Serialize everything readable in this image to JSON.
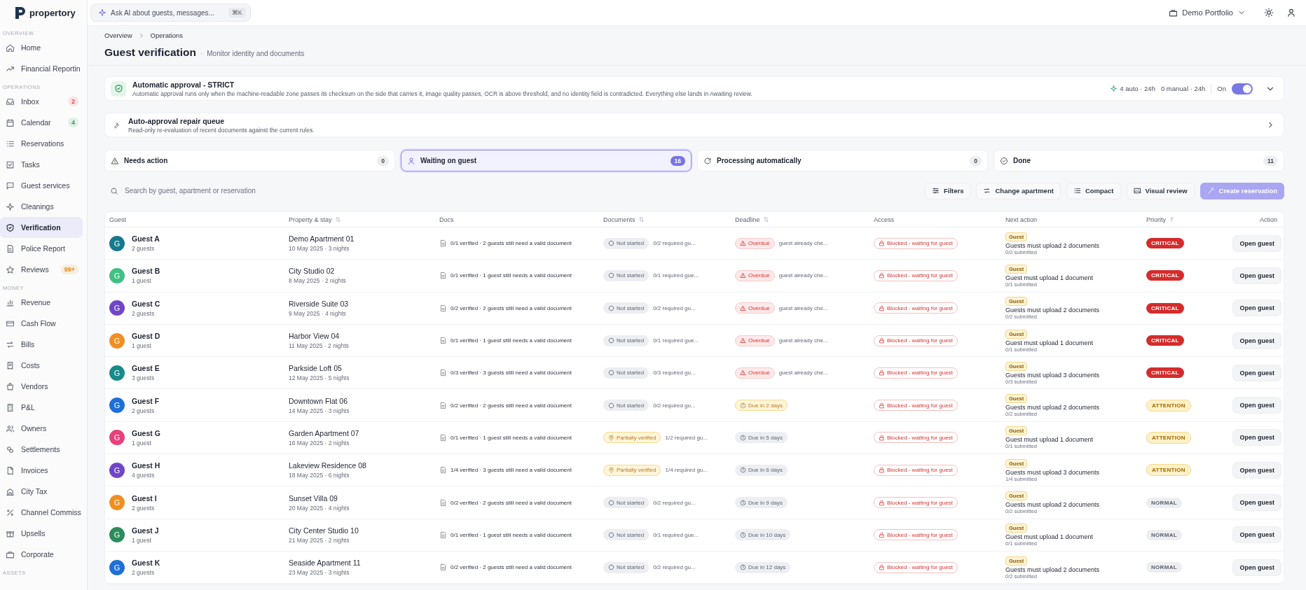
{
  "brand": {
    "name": "propertory"
  },
  "ai_search": {
    "placeholder": "Ask AI about guests, messages...",
    "shortcut": "⌘K"
  },
  "topbar": {
    "portfolio": "Demo Portfolio"
  },
  "sidebar": {
    "sections": [
      {
        "label": "OVERVIEW",
        "items": [
          {
            "label": "Home",
            "selected": false
          },
          {
            "label": "Financial Reportin",
            "selected": false
          }
        ]
      },
      {
        "label": "OPERATIONS",
        "items": [
          {
            "label": "Inbox",
            "selected": false,
            "badge": "2",
            "color": "#e5484d"
          },
          {
            "label": "Calendar",
            "selected": false,
            "badge": "4",
            "color": "#2f9e5b"
          },
          {
            "label": "Reservations",
            "selected": false
          },
          {
            "label": "Tasks",
            "selected": false
          },
          {
            "label": "Guest services",
            "selected": false
          },
          {
            "label": "Cleanings",
            "selected": false
          },
          {
            "label": "Verification",
            "selected": true
          },
          {
            "label": "Police Report",
            "selected": false
          },
          {
            "label": "Reviews",
            "selected": false,
            "badge": "99+",
            "color": "#e8891c"
          }
        ]
      },
      {
        "label": "MONEY",
        "items": [
          {
            "label": "Revenue",
            "selected": false
          },
          {
            "label": "Cash Flow",
            "selected": false
          },
          {
            "label": "Bills",
            "selected": false
          },
          {
            "label": "Costs",
            "selected": false
          },
          {
            "label": "Vendors",
            "selected": false
          },
          {
            "label": "P&L",
            "selected": false
          },
          {
            "label": "Owners",
            "selected": false
          },
          {
            "label": "Settlements",
            "selected": false
          },
          {
            "label": "Invoices",
            "selected": false
          },
          {
            "label": "City Tax",
            "selected": false
          },
          {
            "label": "Channel Commiss",
            "selected": false
          },
          {
            "label": "Upsells",
            "selected": false
          },
          {
            "label": "Corporate",
            "selected": false
          }
        ]
      },
      {
        "label": "ASSETS"
      }
    ]
  },
  "breadcrumb": [
    "Overview",
    "Operations"
  ],
  "page": {
    "title": "Guest verification",
    "separator": "·",
    "subtitle": "Monitor identity and documents"
  },
  "approval": {
    "title": "Automatic approval - STRICT",
    "description": "Automatic approval runs only when the machine-readable zone passes its checksum on the side that carries it, image quality passes, OCR is above threshold, and no identity field is contradicted. Everything else lands in Awaiting review.",
    "auto_stat": "4 auto · 24h",
    "manual_stat": "0 manual · 24h",
    "toggle_label": "On",
    "toggle_on": true
  },
  "repair": {
    "title": "Auto-approval repair queue",
    "description": "Read-only re-evaluation of recent documents against the current rules."
  },
  "tabs": [
    {
      "kind": "attention",
      "label": "Needs action",
      "count": "0",
      "selected": false
    },
    {
      "kind": "waiting",
      "label": "Waiting on guest",
      "count": "16",
      "selected": true
    },
    {
      "kind": "processing",
      "label": "Processing automatically",
      "count": "0",
      "selected": false
    },
    {
      "kind": "done",
      "label": "Done",
      "count": "11",
      "selected": false
    }
  ],
  "search": {
    "placeholder": "Search by guest, apartment or reservation"
  },
  "toolbar": [
    {
      "label": "Filters",
      "kind": "normal"
    },
    {
      "label": "Change apartment",
      "kind": "normal"
    },
    {
      "label": "Compact",
      "kind": "normal"
    },
    {
      "label": "Visual review",
      "kind": "normal"
    },
    {
      "label": "Create reservation",
      "kind": "primary"
    }
  ],
  "table": {
    "columns": [
      {
        "label": "Guest",
        "sortable": false,
        "sorted": false
      },
      {
        "label": "Property & stay",
        "sortable": true,
        "sorted": false
      },
      {
        "label": "Docs",
        "sortable": false,
        "sorted": false
      },
      {
        "label": "Documents",
        "sortable": true,
        "sorted": false
      },
      {
        "label": "Deadline",
        "sortable": true,
        "sorted": false
      },
      {
        "label": "Access",
        "sortable": false,
        "sorted": false
      },
      {
        "label": "Next action",
        "sortable": false,
        "sorted": false
      },
      {
        "label": "Priority",
        "sortable": false,
        "sorted": true
      },
      {
        "label": "Action",
        "sortable": false,
        "sorted": false
      }
    ],
    "rows": [
      {
        "avatar": "G",
        "color": "#17798c",
        "name": "Guest A",
        "guests": "2 guests",
        "property": "Demo Apartment 01",
        "stay": "10 May 2025 · 3 nights",
        "docs": "0/1 verified · 2 guests still need a valid document",
        "doc_status": {
          "kind": "not_started",
          "label": "Not started"
        },
        "doc_detail": "0/2 required gu...",
        "deadline": {
          "kind": "overdue",
          "label": "Overdue"
        },
        "deadline_note": "guest already che...",
        "access": "Blocked - waiting for guest",
        "tag": "Guest",
        "next_action": "Guests must upload 2 documents",
        "submitted": "0/2 submitted",
        "priority": {
          "kind": "critical",
          "label": "CRITICAL"
        },
        "button": "Open guest"
      },
      {
        "avatar": "G",
        "color": "#42bf85",
        "name": "Guest B",
        "guests": "1 guest",
        "property": "City Studio 02",
        "stay": "8 May 2025 · 2 nights",
        "docs": "0/1 verified · 1 guest still needs a valid document",
        "doc_status": {
          "kind": "not_started",
          "label": "Not started"
        },
        "doc_detail": "0/1 required gue...",
        "deadline": {
          "kind": "overdue",
          "label": "Overdue"
        },
        "deadline_note": "guest already che...",
        "access": "Blocked - waiting for guest",
        "tag": "Guest",
        "next_action": "Guest must upload 1 document",
        "submitted": "0/1 submitted",
        "priority": {
          "kind": "critical",
          "label": "CRITICAL"
        },
        "button": "Open guest"
      },
      {
        "avatar": "G",
        "color": "#6f47c6",
        "name": "Guest C",
        "guests": "2 guests",
        "property": "Riverside Suite 03",
        "stay": "9 May 2025 · 4 nights",
        "docs": "0/2 verified · 2 guests still need a valid document",
        "doc_status": {
          "kind": "not_started",
          "label": "Not started"
        },
        "doc_detail": "0/2 required gu...",
        "deadline": {
          "kind": "overdue",
          "label": "Overdue"
        },
        "deadline_note": "guest already che...",
        "access": "Blocked - waiting for guest",
        "tag": "Guest",
        "next_action": "Guests must upload 2 documents",
        "submitted": "0/2 submitted",
        "priority": {
          "kind": "critical",
          "label": "CRITICAL"
        },
        "button": "Open guest"
      },
      {
        "avatar": "G",
        "color": "#ef8f22",
        "name": "Guest D",
        "guests": "1 guest",
        "property": "Harbor View 04",
        "stay": "11 May 2025 · 2 nights",
        "docs": "0/1 verified · 1 guest still needs a valid document",
        "doc_status": {
          "kind": "not_started",
          "label": "Not started"
        },
        "doc_detail": "0/1 required gue...",
        "deadline": {
          "kind": "overdue",
          "label": "Overdue"
        },
        "deadline_note": "guest already che...",
        "access": "Blocked - waiting for guest",
        "tag": "Guest",
        "next_action": "Guest must upload 1 document",
        "submitted": "0/1 submitted",
        "priority": {
          "kind": "critical",
          "label": "CRITICAL"
        },
        "button": "Open guest"
      },
      {
        "avatar": "G",
        "color": "#198a8a",
        "name": "Guest E",
        "guests": "3 guests",
        "property": "Parkside Loft 05",
        "stay": "12 May 2025 · 5 nights",
        "docs": "0/3 verified · 3 guests still need a valid document",
        "doc_status": {
          "kind": "not_started",
          "label": "Not started"
        },
        "doc_detail": "0/3 required gu...",
        "deadline": {
          "kind": "overdue",
          "label": "Overdue"
        },
        "deadline_note": "guest already che...",
        "access": "Blocked - waiting for guest",
        "tag": "Guest",
        "next_action": "Guests must upload 3 documents",
        "submitted": "0/3 submitted",
        "priority": {
          "kind": "critical",
          "label": "CRITICAL"
        },
        "button": "Open guest"
      },
      {
        "avatar": "G",
        "color": "#1f6fd6",
        "name": "Guest F",
        "guests": "2 guests",
        "property": "Downtown Flat 06",
        "stay": "14 May 2025 · 3 nights",
        "docs": "0/2 verified · 2 guests still need a valid document",
        "doc_status": {
          "kind": "not_started",
          "label": "Not started"
        },
        "doc_detail": "0/2 required gu...",
        "deadline": {
          "kind": "soon",
          "label": "Due in 2 days"
        },
        "access": "Blocked - waiting for guest",
        "tag": "Guest",
        "next_action": "Guests must upload 2 documents",
        "submitted": "0/2 submitted",
        "priority": {
          "kind": "attention",
          "label": "ATTENTION"
        },
        "button": "Open guest"
      },
      {
        "avatar": "G",
        "color": "#e8407b",
        "name": "Guest G",
        "guests": "1 guest",
        "property": "Garden Apartment 07",
        "stay": "16 May 2025 · 2 nights",
        "docs": "0/1 verified · 1 guest still needs a valid document",
        "doc_status": {
          "kind": "partial",
          "label": "Partially verified"
        },
        "doc_detail": "1/2 required gu...",
        "deadline": {
          "kind": "later",
          "label": "Due in 5 days"
        },
        "access": "Blocked - waiting for guest",
        "tag": "Guest",
        "next_action": "Guest must upload 1 document",
        "submitted": "0/1 submitted",
        "priority": {
          "kind": "attention",
          "label": "ATTENTION"
        },
        "button": "Open guest"
      },
      {
        "avatar": "G",
        "color": "#6f47c6",
        "name": "Guest H",
        "guests": "4 guests",
        "property": "Lakeview Residence 08",
        "stay": "18 May 2025 · 6 nights",
        "docs": "1/4 verified · 3 guests still need a valid document",
        "doc_status": {
          "kind": "partial",
          "label": "Partially verified"
        },
        "doc_detail": "1/4 required gu...",
        "deadline": {
          "kind": "later",
          "label": "Due in 6 days"
        },
        "access": "Blocked - waiting for guest",
        "tag": "Guest",
        "next_action": "Guests must upload 3 documents",
        "submitted": "1/4 submitted",
        "priority": {
          "kind": "attention",
          "label": "ATTENTION"
        },
        "button": "Open guest"
      },
      {
        "avatar": "G",
        "color": "#ef8f22",
        "name": "Guest I",
        "guests": "2 guests",
        "property": "Sunset Villa 09",
        "stay": "20 May 2025 · 4 nights",
        "docs": "0/2 verified · 2 guests still need a valid document",
        "doc_status": {
          "kind": "not_started",
          "label": "Not started"
        },
        "doc_detail": "0/2 required gu...",
        "deadline": {
          "kind": "later",
          "label": "Due in 9 days"
        },
        "access": "Blocked - waiting for guest",
        "tag": "Guest",
        "next_action": "Guests must upload 2 documents",
        "submitted": "0/2 submitted",
        "priority": {
          "kind": "normal",
          "label": "NORMAL"
        },
        "button": "Open guest"
      },
      {
        "avatar": "G",
        "color": "#2b8c5c",
        "name": "Guest J",
        "guests": "1 guest",
        "property": "City Center Studio 10",
        "stay": "21 May 2025 · 2 nights",
        "docs": "0/1 verified · 1 guest still needs a valid document",
        "doc_status": {
          "kind": "not_started",
          "label": "Not started"
        },
        "doc_detail": "0/1 required gue...",
        "deadline": {
          "kind": "later",
          "label": "Due in 10 days"
        },
        "access": "Blocked - waiting for guest",
        "tag": "Guest",
        "next_action": "Guest must upload 1 document",
        "submitted": "0/1 submitted",
        "priority": {
          "kind": "normal",
          "label": "NORMAL"
        },
        "button": "Open guest"
      },
      {
        "avatar": "G",
        "color": "#1f6fd6",
        "name": "Guest K",
        "guests": "2 guests",
        "property": "Seaside Apartment 11",
        "stay": "23 May 2025 · 3 nights",
        "docs": "0/2 verified · 2 guests still need a valid document",
        "doc_status": {
          "kind": "not_started",
          "label": "Not started"
        },
        "doc_detail": "0/2 required gu...",
        "deadline": {
          "kind": "later",
          "label": "Due in 12 days"
        },
        "access": "Blocked - waiting for guest",
        "tag": "Guest",
        "next_action": "Guests must upload 2 documents",
        "submitted": "0/2 submitted",
        "priority": {
          "kind": "normal",
          "label": "NORMAL"
        },
        "button": "Open guest"
      }
    ]
  }
}
